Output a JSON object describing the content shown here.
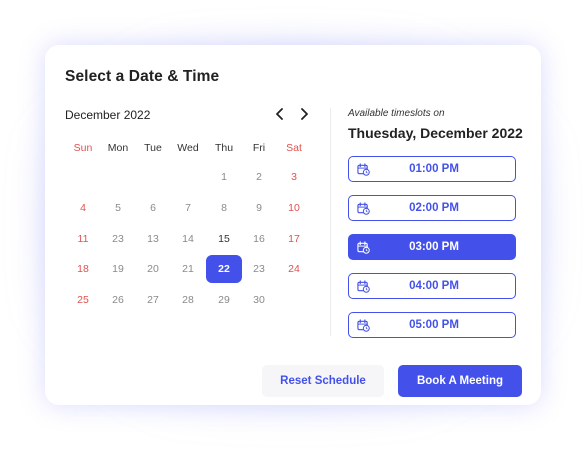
{
  "title": "Select a Date & Time",
  "calendar": {
    "month_label": "December 2022",
    "weekdays": [
      "Sun",
      "Mon",
      "Tue",
      "Wed",
      "Thu",
      "Fri",
      "Sat"
    ],
    "weeks": [
      [
        "",
        "",
        "",
        "",
        "1",
        "2",
        "3"
      ],
      [
        "4",
        "5",
        "6",
        "7",
        "8",
        "9",
        "10"
      ],
      [
        "11",
        "23",
        "13",
        "14",
        "15",
        "16",
        "17"
      ],
      [
        "18",
        "19",
        "20",
        "21",
        "22",
        "23",
        "24"
      ],
      [
        "25",
        "26",
        "27",
        "28",
        "29",
        "30",
        ""
      ]
    ],
    "selected_day": "22",
    "today_day": "15"
  },
  "timeslots": {
    "label": "Available timeslots on",
    "date_heading": "Thuesday, December 2022",
    "slots": [
      {
        "time": "01:00 PM",
        "selected": false
      },
      {
        "time": "02:00 PM",
        "selected": false
      },
      {
        "time": "03:00 PM",
        "selected": true
      },
      {
        "time": "04:00 PM",
        "selected": false
      },
      {
        "time": "05:00 PM",
        "selected": false
      }
    ]
  },
  "actions": {
    "reset_label": "Reset Schedule",
    "book_label": "Book A Meeting"
  },
  "colors": {
    "accent": "#4351ea",
    "weekend": "#e0524f"
  }
}
